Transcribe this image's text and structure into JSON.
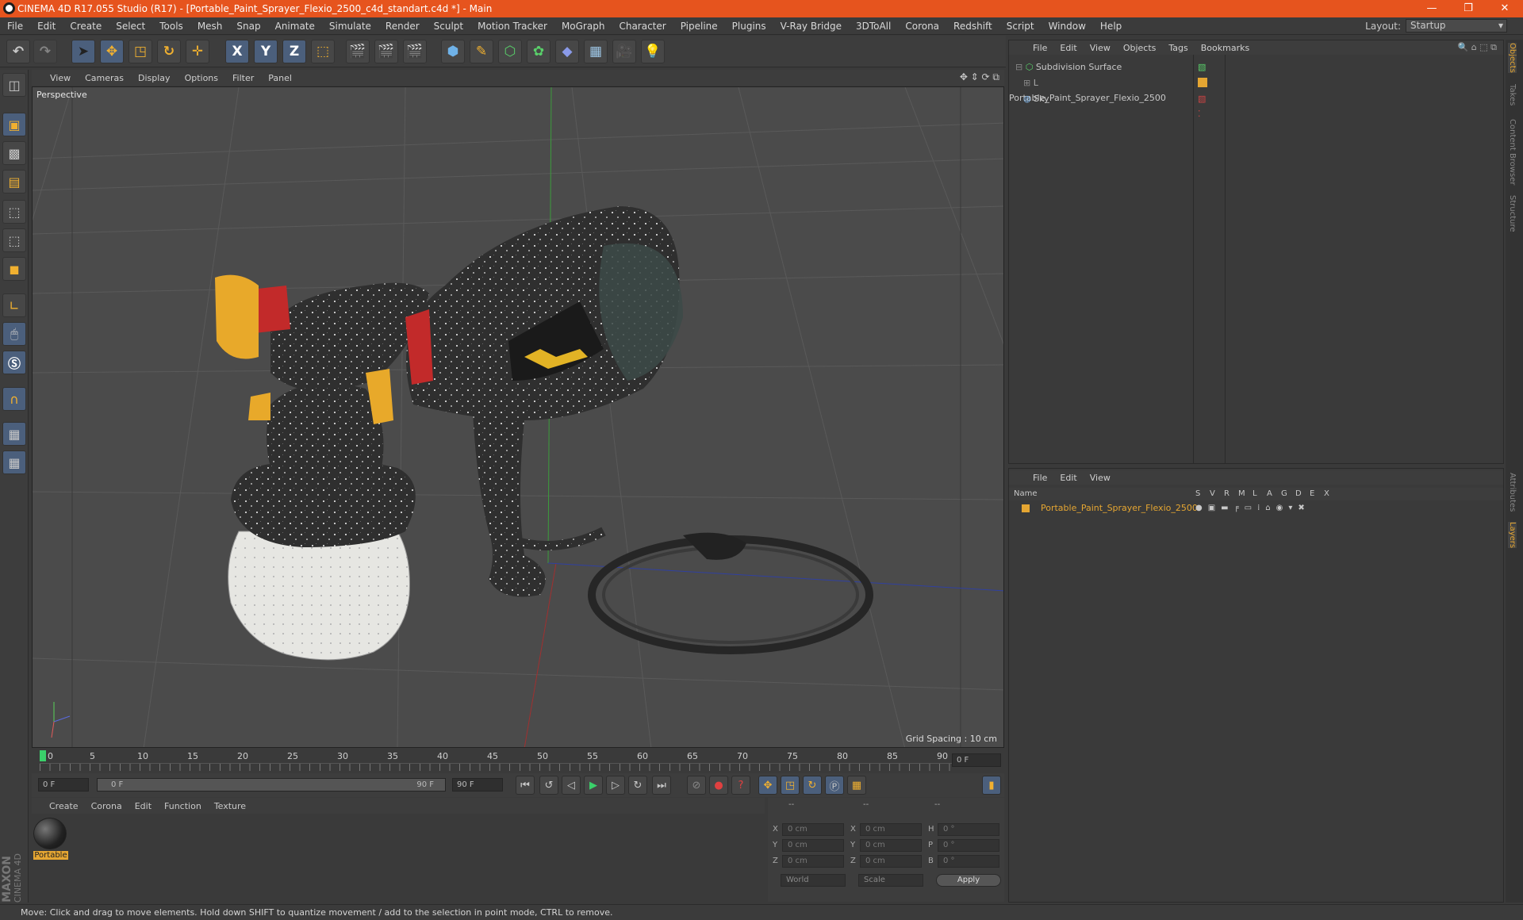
{
  "titlebar": {
    "title": "CINEMA 4D R17.055 Studio (R17) - [Portable_Paint_Sprayer_Flexio_2500_c4d_standart.c4d *] - Main",
    "minimize": "—",
    "maximize": "❐",
    "close": "✕"
  },
  "menubar": [
    "File",
    "Edit",
    "Create",
    "Select",
    "Tools",
    "Mesh",
    "Snap",
    "Animate",
    "Simulate",
    "Render",
    "Sculpt",
    "Motion Tracker",
    "MoGraph",
    "Character",
    "Pipeline",
    "Plugins",
    "V-Ray Bridge",
    "3DToAll",
    "Corona",
    "Redshift",
    "Script",
    "Window",
    "Help"
  ],
  "layout": {
    "label": "Layout:",
    "value": "Startup"
  },
  "toolbar": {
    "axis_x": "X",
    "axis_y": "Y",
    "axis_z": "Z"
  },
  "viewport_menu": [
    "View",
    "Cameras",
    "Display",
    "Options",
    "Filter",
    "Panel"
  ],
  "viewport": {
    "label": "Perspective",
    "grid_spacing": "Grid Spacing : 10 cm"
  },
  "timeline": {
    "ticks": [
      "0",
      "5",
      "10",
      "15",
      "20",
      "25",
      "30",
      "35",
      "40",
      "45",
      "50",
      "55",
      "60",
      "65",
      "70",
      "75",
      "80",
      "85",
      "90"
    ],
    "end_field": "0 F"
  },
  "transport": {
    "start": "0 F",
    "range_start": "0 F",
    "range_end": "90 F",
    "end": "90 F"
  },
  "material_menu": [
    "Create",
    "Corona",
    "Edit",
    "Function",
    "Texture"
  ],
  "material": {
    "name": "Portable"
  },
  "coords": {
    "header": [
      "--",
      "--",
      "--"
    ],
    "rows": [
      {
        "a": "X",
        "av": "0 cm",
        "b": "X",
        "bv": "0 cm",
        "c": "H",
        "cv": "0 °"
      },
      {
        "a": "Y",
        "av": "0 cm",
        "b": "Y",
        "bv": "0 cm",
        "c": "P",
        "cv": "0 °"
      },
      {
        "a": "Z",
        "av": "0 cm",
        "b": "Z",
        "bv": "0 cm",
        "c": "B",
        "cv": "0 °"
      }
    ],
    "world": "World",
    "scale": "Scale",
    "apply": "Apply"
  },
  "objects_menu": [
    "File",
    "Edit",
    "View",
    "Objects",
    "Tags",
    "Bookmarks"
  ],
  "objects": [
    {
      "name": "Subdivision Surface"
    },
    {
      "name": "Portable_Paint_Sprayer_Flexio_2500"
    },
    {
      "name": "Sky"
    }
  ],
  "layers_menu": [
    "File",
    "Edit",
    "View"
  ],
  "layers": {
    "columns": [
      "Name",
      "S",
      "V",
      "R",
      "M",
      "L",
      "A",
      "G",
      "D",
      "E",
      "X"
    ],
    "row": "Portable_Paint_Sprayer_Flexio_2500"
  },
  "right_tabs": [
    "Objects",
    "Takes",
    "Content Browser",
    "Structure",
    "Attributes",
    "Layers"
  ],
  "maxon": {
    "brand": "MAXON",
    "product": "CINEMA 4D"
  },
  "status": "Move: Click and drag to move elements. Hold down SHIFT to quantize movement / add to the selection in point mode, CTRL to remove.",
  "colors": {
    "accent": "#e6541e",
    "selection": "#e5a632",
    "tool_blue": "#4b5f7c"
  }
}
